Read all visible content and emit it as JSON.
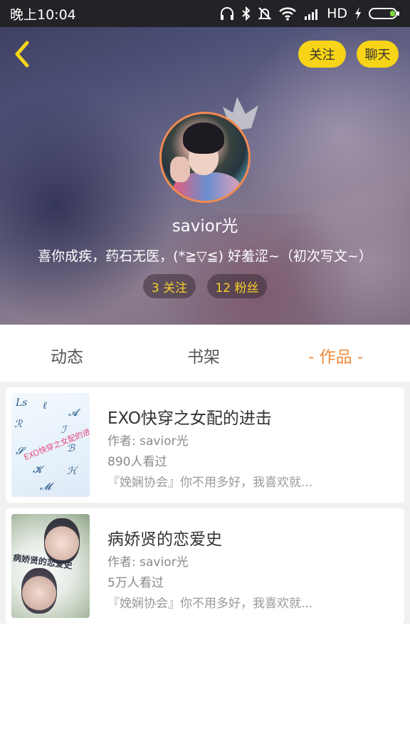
{
  "status_bar": {
    "time": "晚上10:04",
    "network": "HD",
    "icons": [
      "headphones-icon",
      "bluetooth-icon",
      "mute-icon",
      "wifi-icon",
      "signal-icon",
      "charging-icon",
      "battery-icon"
    ]
  },
  "header": {
    "follow_label": "关注",
    "chat_label": "聊天",
    "accent_color": "#f7d417"
  },
  "profile": {
    "username": "savior光",
    "bio": "喜你成疾，药石无医，(*≧▽≦) 好羞涩~（初次写文~）",
    "following": "3 关注",
    "fans": "12 粉丝"
  },
  "tabs": [
    {
      "label": "动态"
    },
    {
      "label": "书架"
    },
    {
      "label": "- 作品 -",
      "active": true
    }
  ],
  "active_tab_color": "#f28a3c",
  "works": [
    {
      "title": "EXO快穿之女配的进击",
      "author": "作者: savior光",
      "views": "890人看过",
      "desc": "『娩娴协会』你不用多好，我喜欢就...",
      "cover_text": "EXO快穿之女配的进击"
    },
    {
      "title": "病娇贤的恋爱史",
      "author": "作者: savior光",
      "views": "5万人看过",
      "desc": "『娩娴协会』你不用多好，我喜欢就...",
      "cover_text": "病娇贤的恋爱史"
    }
  ]
}
